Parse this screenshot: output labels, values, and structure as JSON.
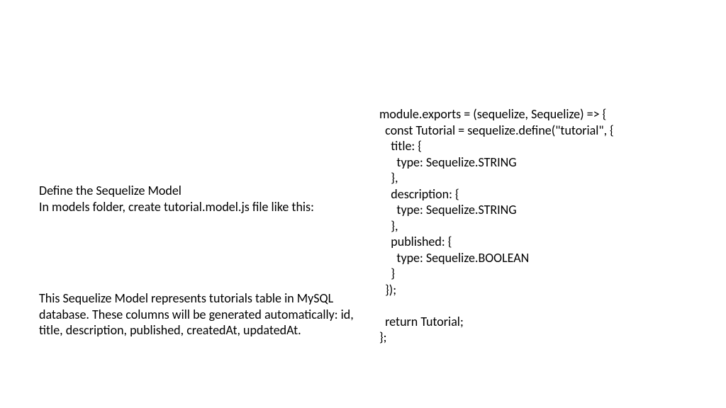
{
  "left": {
    "heading_line1": "Define the Sequelize Model",
    "heading_line2": "In models folder, create tutorial.model.js file like this:",
    "paragraph": "This Sequelize Model represents tutorials table in MySQL database. These columns will be generated automatically: id, title, description, published, createdAt, updatedAt."
  },
  "code": "module.exports = (sequelize, Sequelize) => {\n  const Tutorial = sequelize.define(\"tutorial\", {\n    title: {\n      type: Sequelize.STRING\n    },\n    description: {\n      type: Sequelize.STRING\n    },\n    published: {\n      type: Sequelize.BOOLEAN\n    }\n  });\n\n  return Tutorial;\n};"
}
